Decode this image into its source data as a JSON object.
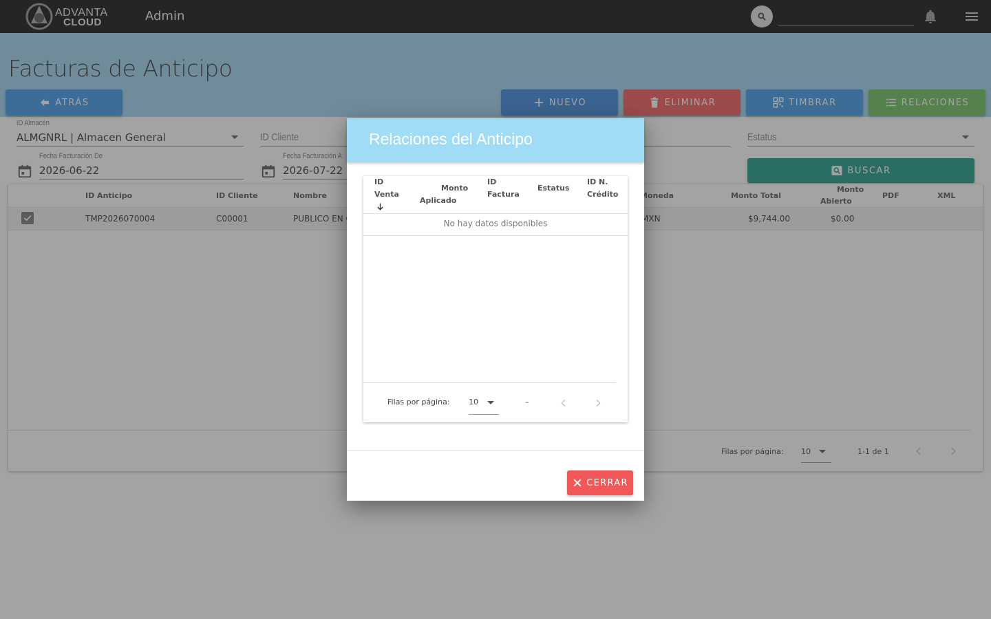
{
  "topbar": {
    "logo_line1": "ADVANTA",
    "logo_line2": "CLOUD",
    "app_title": "Admin",
    "search_placeholder": ""
  },
  "page": {
    "title": "Facturas de Anticipo"
  },
  "toolbar": {
    "atras_label": "ATRÁS",
    "nuevo_label": "NUEVO",
    "eliminar_label": "ELIMINAR",
    "timbrar_label": "TIMBRAR",
    "relaciones_label": "RELACIONES",
    "buscar_label": "BUSCAR"
  },
  "filters": {
    "almacen": {
      "label": "ID Almacén",
      "value": "ALMGNRL | Almacen General"
    },
    "cliente": {
      "placeholder": "ID Cliente"
    },
    "estatus": {
      "placeholder": "Estatus"
    },
    "fecha_de": {
      "label": "Fecha Facturación De",
      "value": "2026-06-22"
    },
    "fecha_a": {
      "label": "Fecha Facturación A",
      "value": "2026-07-22"
    }
  },
  "table": {
    "headers": {
      "id_anticipo": "ID Anticipo",
      "id_cliente": "ID Cliente",
      "nombre": "Nombre",
      "moneda": "Moneda",
      "monto_total": "Monto Total",
      "monto_abierto_1": "Monto",
      "monto_abierto_2": "Abierto",
      "pdf": "PDF",
      "xml": "XML"
    },
    "rows": [
      {
        "id_anticipo": "TMP2026070004",
        "id_cliente": "C00001",
        "nombre": "PUBLICO EN G",
        "moneda": "MXN",
        "monto_total": "$9,744.00",
        "monto_abierto": "$0.00"
      }
    ],
    "footer": {
      "rows_per_page_label": "Filas por página:",
      "rows_per_page_value": "10",
      "range": "1-1 de 1"
    }
  },
  "dialog": {
    "title": "Relaciones del Anticipo",
    "headers": {
      "id_venta_1": "ID",
      "id_venta_2": "Venta",
      "monto_aplicado_1": "Monto",
      "monto_aplicado_2": "Aplicado",
      "id_factura_1": "ID",
      "id_factura_2": "Factura",
      "estatus": "Estatus",
      "id_nc_1": "ID N.",
      "id_nc_2": "Crédito"
    },
    "no_data": "No hay datos disponibles",
    "footer": {
      "rows_per_page_label": "Filas por página:",
      "rows_per_page_value": "10",
      "range": "–"
    },
    "cerrar_label": "CERRAR"
  },
  "colors": {
    "topbar": "#111111",
    "header_band": "#9fd4ee",
    "atras": "#3d9ae8",
    "nuevo": "#3a86dd",
    "eliminar": "#f05a5a",
    "timbrar": "#3d9ae8",
    "relaciones": "#6cc15c",
    "buscar": "#1c9a84",
    "dialog_header": "#a1dcf6",
    "cerrar": "#f25757"
  }
}
